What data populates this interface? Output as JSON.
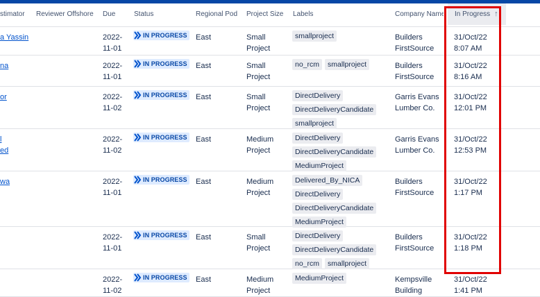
{
  "columns": {
    "estimator": "stimator",
    "reviewer_offshore": "Reviewer Offshore",
    "due": "Due",
    "status": "Status",
    "regional_pod": "Regional Pod",
    "project_size": "Project Size",
    "labels": "Labels",
    "company_name": "Company Name",
    "in_progress": "In Progress"
  },
  "rows": [
    {
      "estimator": "a Yassin",
      "due1": "2022-",
      "due2": "11-01",
      "status": "IN PROGRESS",
      "pod": "East",
      "size1": "Small",
      "size2": "Project",
      "labels": [
        "smallproject"
      ],
      "company1": "Builders",
      "company2": "FirstSource",
      "progress1": "31/Oct/22",
      "progress2": "8:07 AM"
    },
    {
      "estimator": "na",
      "due1": "2022-",
      "due2": "11-01",
      "status": "IN PROGRESS",
      "pod": "East",
      "size1": "Small",
      "size2": "Project",
      "labels": [
        "no_rcm",
        "smallproject"
      ],
      "company1": "Builders",
      "company2": "FirstSource",
      "progress1": "31/Oct/22",
      "progress2": "8:16 AM"
    },
    {
      "estimator": "or",
      "due1": "2022-",
      "due2": "11-02",
      "status": "IN PROGRESS",
      "pod": "East",
      "size1": "Small",
      "size2": "Project",
      "labels": [
        "DirectDelivery",
        "DirectDeliveryCandidate",
        "smallproject"
      ],
      "company1": "Garris Evans",
      "company2": "Lumber Co.",
      "progress1": "31/Oct/22",
      "progress2": "12:01 PM"
    },
    {
      "estimator": "l",
      "estimator2": "ed",
      "due1": "2022-",
      "due2": "11-02",
      "status": "IN PROGRESS",
      "pod": "East",
      "size1": "Medium",
      "size2": "Project",
      "labels": [
        "DirectDelivery",
        "DirectDeliveryCandidate",
        "MediumProject"
      ],
      "company1": "Garris Evans",
      "company2": "Lumber Co.",
      "progress1": "31/Oct/22",
      "progress2": "12:53 PM"
    },
    {
      "estimator": "wa",
      "due1": "2022-",
      "due2": "11-01",
      "status": "IN PROGRESS",
      "pod": "East",
      "size1": "Medium",
      "size2": "Project",
      "labels": [
        "Delivered_By_NICA",
        "DirectDelivery",
        "DirectDeliveryCandidate",
        "MediumProject"
      ],
      "company1": "Builders",
      "company2": "FirstSource",
      "progress1": "31/Oct/22",
      "progress2": "1:17 PM"
    },
    {
      "estimator": "",
      "due1": "2022-",
      "due2": "11-01",
      "status": "IN PROGRESS",
      "pod": "East",
      "size1": "Small",
      "size2": "Project",
      "labels": [
        "DirectDelivery",
        "DirectDeliveryCandidate",
        "no_rcm",
        "smallproject"
      ],
      "company1": "Builders",
      "company2": "FirstSource",
      "progress1": "31/Oct/22",
      "progress2": "1:18 PM"
    },
    {
      "estimator": "",
      "due1": "2022-",
      "due2": "11-02",
      "status": "IN PROGRESS",
      "pod": "East",
      "size1": "Medium",
      "size2": "Project",
      "labels": [
        "MediumProject"
      ],
      "company1": "Kempsville",
      "company2": "Building",
      "progress1": "31/Oct/22",
      "progress2": "1:41 PM"
    }
  ],
  "colors": {
    "status_bg": "#deebff",
    "status_text": "#0747a6",
    "highlight": "#e00000",
    "link": "#0052cc"
  },
  "icons": {
    "status": "double-chevron-right-icon",
    "sort": "arrow-up-icon"
  }
}
